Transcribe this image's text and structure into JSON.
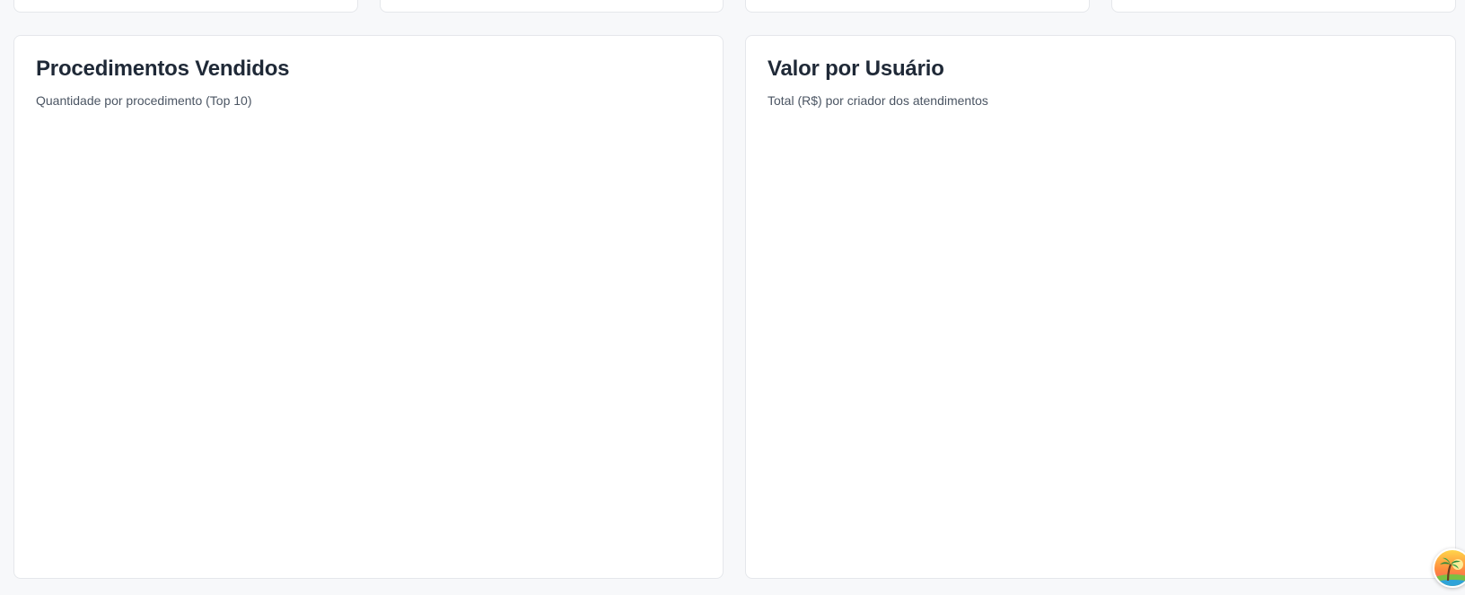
{
  "panels": [
    {
      "title": "Procedimentos Vendidos",
      "subtitle": "Quantidade por procedimento (Top 10)"
    },
    {
      "title": "Valor por Usuário",
      "subtitle": "Total (R$) por criador dos atendimentos"
    }
  ],
  "avatar": {
    "icon": "beach-palm-avatar"
  },
  "colors": {
    "background": "#f7f8fa",
    "card": "#ffffff",
    "border": "#e5e7eb"
  }
}
